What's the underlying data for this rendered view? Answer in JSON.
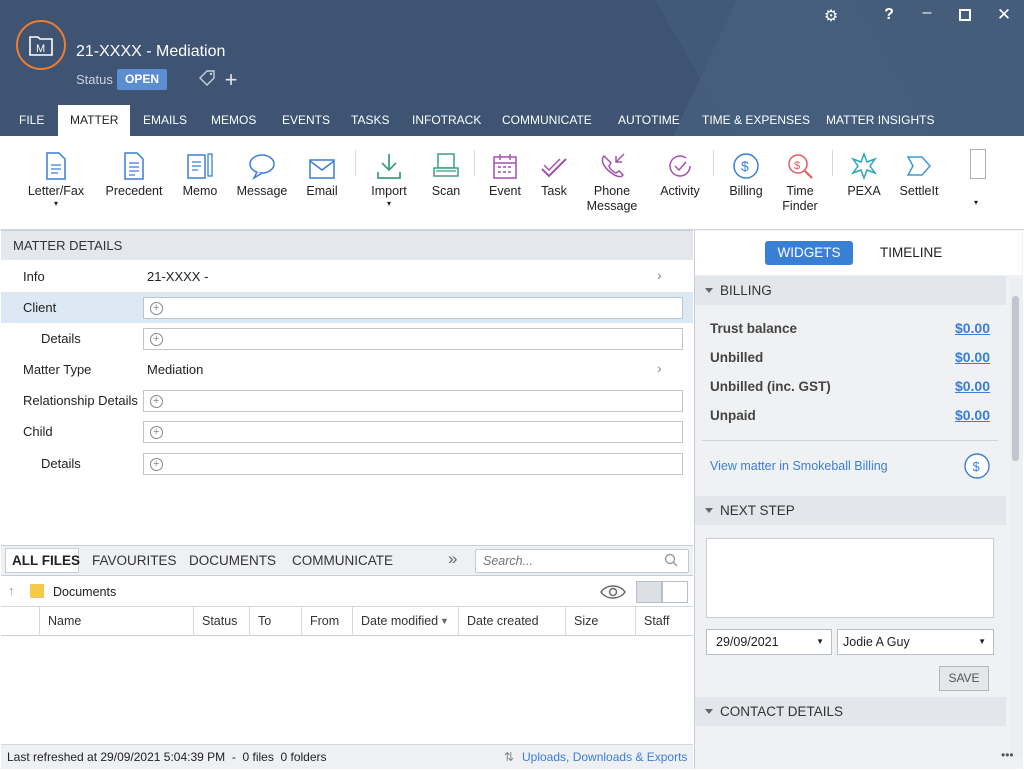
{
  "header": {
    "title": "21-XXXX - Mediation",
    "status_label": "Status",
    "status_value": "OPEN"
  },
  "tabs": [
    {
      "label": "FILE"
    },
    {
      "label": "MATTER"
    },
    {
      "label": "EMAILS"
    },
    {
      "label": "MEMOS"
    },
    {
      "label": "EVENTS"
    },
    {
      "label": "TASKS"
    },
    {
      "label": "INFOTRACK"
    },
    {
      "label": "COMMUNICATE"
    },
    {
      "label": "AUTOTIME"
    },
    {
      "label": "TIME & EXPENSES"
    },
    {
      "label": "MATTER INSIGHTS"
    }
  ],
  "ribbon": [
    {
      "label": "Letter/Fax",
      "icon": "letter-icon"
    },
    {
      "label": "Precedent",
      "icon": "precedent-icon"
    },
    {
      "label": "Memo",
      "icon": "memo-icon"
    },
    {
      "label": "Message",
      "icon": "message-icon"
    },
    {
      "label": "Email",
      "icon": "email-icon"
    },
    {
      "label": "Import",
      "icon": "import-icon"
    },
    {
      "label": "Scan",
      "icon": "scan-icon"
    },
    {
      "label": "Event",
      "icon": "calendar-icon"
    },
    {
      "label": "Task",
      "icon": "task-icon"
    },
    {
      "label": "Phone",
      "label2": "Message",
      "icon": "phone-icon"
    },
    {
      "label": "Activity",
      "icon": "activity-icon"
    },
    {
      "label": "Billing",
      "icon": "billing-icon"
    },
    {
      "label": "Time",
      "label2": "Finder",
      "icon": "time-finder-icon"
    },
    {
      "label": "PEXA",
      "icon": "pexa-icon"
    },
    {
      "label": "SettleIt",
      "icon": "settleit-icon"
    }
  ],
  "matter_details": {
    "title": "MATTER DETAILS",
    "rows": [
      {
        "label": "Info",
        "value": "21-XXXX -"
      },
      {
        "label": "Client",
        "value": ""
      },
      {
        "label": "Details",
        "value": ""
      },
      {
        "label": "Matter Type",
        "value": "Mediation"
      },
      {
        "label": "Relationship Details",
        "value": ""
      },
      {
        "label": "Child",
        "value": ""
      },
      {
        "label": "Details",
        "value": ""
      }
    ]
  },
  "files": {
    "tabs": [
      "ALL FILES",
      "FAVOURITES",
      "DOCUMENTS",
      "COMMUNICATE"
    ],
    "search_placeholder": "Search...",
    "folder": "Documents",
    "columns": [
      "Name",
      "Status",
      "To",
      "From",
      "Date modified",
      "Date created",
      "Size",
      "Staff"
    ],
    "status": "Last refreshed at 29/09/2021 5:04:39 PM  -  0 files  0 folders",
    "uploads_link": "Uploads, Downloads & Exports"
  },
  "right_panel": {
    "tabs": [
      "WIDGETS",
      "TIMELINE"
    ],
    "billing": {
      "title": "BILLING",
      "items": [
        {
          "label": "Trust balance",
          "value": "$0.00"
        },
        {
          "label": "Unbilled",
          "value": "$0.00"
        },
        {
          "label": "Unbilled (inc. GST)",
          "value": "$0.00"
        },
        {
          "label": "Unpaid",
          "value": "$0.00"
        }
      ],
      "link": "View matter in Smokeball Billing"
    },
    "next_step": {
      "title": "NEXT STEP",
      "date": "29/09/2021",
      "staff": "Jodie A Guy",
      "save": "SAVE"
    },
    "contact": {
      "title": "CONTACT DETAILS"
    }
  },
  "colors": {
    "header_bg": "#3e5472",
    "accent": "#3a7fd6",
    "status_badge": "#5b8dd0",
    "logo_ring": "#f07d2c"
  }
}
